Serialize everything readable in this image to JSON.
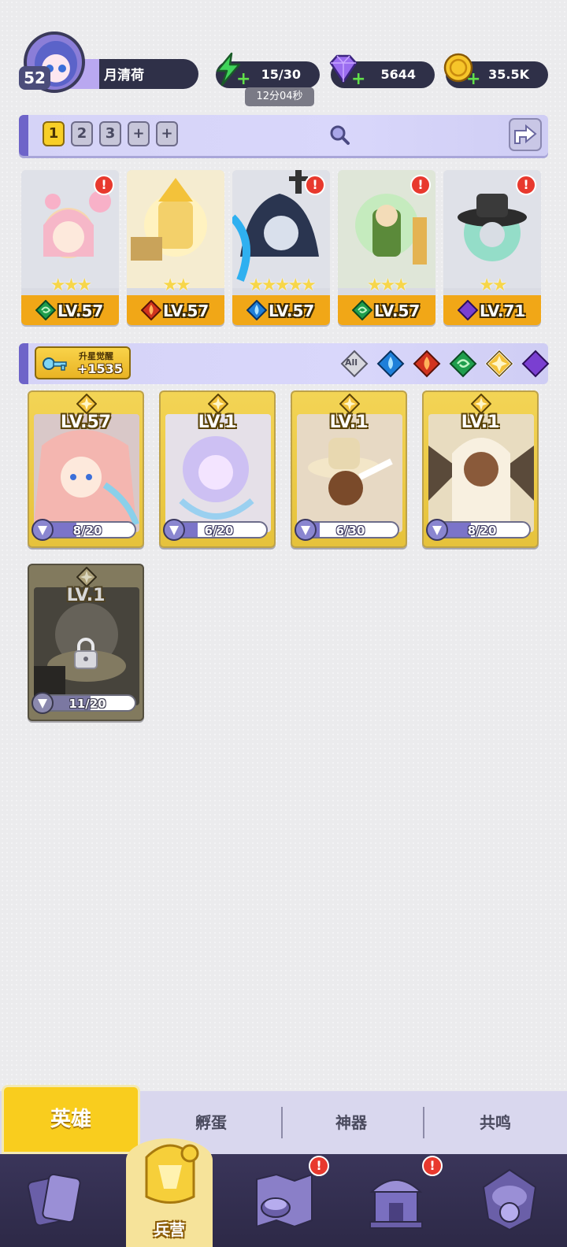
{
  "player": {
    "name": "月清荷",
    "level": "52"
  },
  "resources": {
    "energy": {
      "value": "15/30",
      "timer": "12分04秒",
      "icon": "lightning-icon"
    },
    "gems": {
      "value": "5644",
      "icon": "gem-icon"
    },
    "gold": {
      "value": "35.5K",
      "icon": "coin-icon"
    }
  },
  "team_bar": {
    "slots": [
      "1",
      "2",
      "3",
      "+",
      "+"
    ],
    "active_slot": 0
  },
  "team_heroes": [
    {
      "level": "LV.57",
      "stars": "★★★",
      "element": "wind",
      "alert": "!"
    },
    {
      "level": "LV.57",
      "stars": "★★",
      "element": "fire",
      "alert": ""
    },
    {
      "level": "LV.57",
      "stars": "★★★★★",
      "element": "water",
      "alert": "!"
    },
    {
      "level": "LV.57",
      "stars": "★★★",
      "element": "wind",
      "alert": "!"
    },
    {
      "level": "LV.71",
      "stars": "★★",
      "element": "dark",
      "alert": "!"
    }
  ],
  "awaken": {
    "label": "升星觉醒",
    "value": "+1535"
  },
  "filters": [
    "All",
    "water",
    "fire",
    "wind",
    "light",
    "dark"
  ],
  "cards": [
    {
      "level": "LV.57",
      "progress": "8/20",
      "fill": 0.4
    },
    {
      "level": "LV.1",
      "progress": "6/20",
      "fill": 0.3
    },
    {
      "level": "LV.1",
      "progress": "6/30",
      "fill": 0.2
    },
    {
      "level": "LV.1",
      "progress": "8/20",
      "fill": 0.4
    },
    {
      "level": "LV.1",
      "progress": "11/20",
      "fill": 0.55,
      "locked": true
    }
  ],
  "tabs": [
    "英雄",
    "孵蛋",
    "神器",
    "共鸣"
  ],
  "nav": {
    "active_label": "兵营",
    "alert": "!"
  },
  "colors": {
    "accent": "#f9cd1e",
    "panel": "#d5d3f7",
    "dark": "#2f3048",
    "alert": "#e8392e"
  }
}
